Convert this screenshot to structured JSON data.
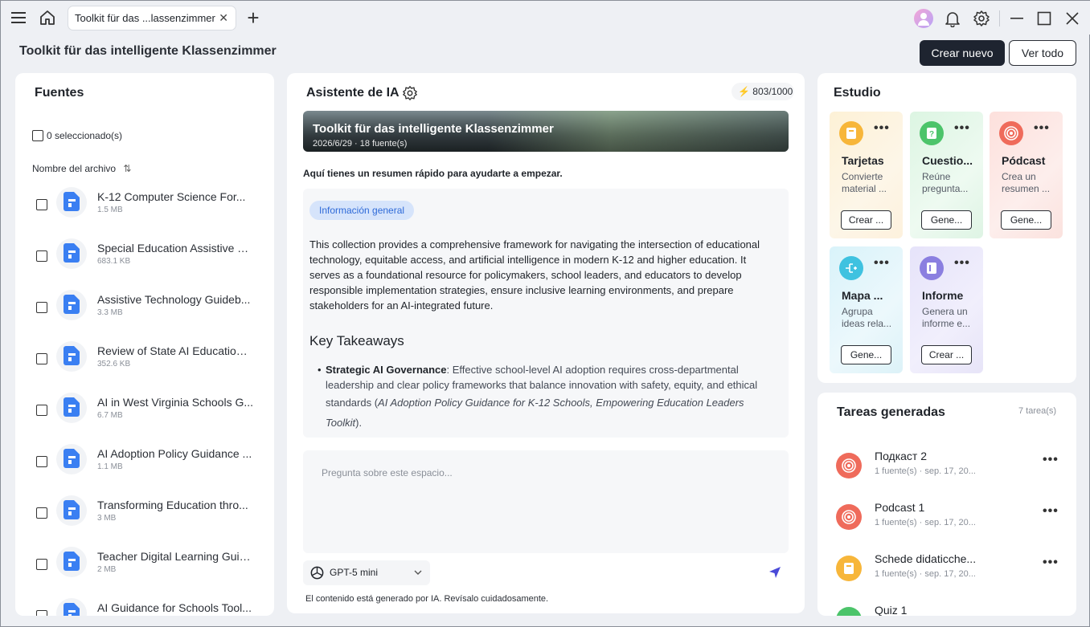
{
  "window": {
    "tab_title": "Toolkit für das ...lassenzimmer",
    "tab_close": "✕",
    "new_tab": "+"
  },
  "header": {
    "page_title": "Toolkit für das intelligente Klassenzimmer",
    "create_new": "Crear nuevo",
    "view_all": "Ver todo"
  },
  "sources": {
    "title": "Fuentes",
    "selected": "0 seleccionado(s)",
    "column": "Nombre del archivo",
    "items": [
      {
        "name": "K-12 Computer Science For...",
        "size": "1.5 MB"
      },
      {
        "name": "Special Education Assistive Te...",
        "size": "683.1 KB"
      },
      {
        "name": "Assistive Technology Guideb...",
        "size": "3.3 MB"
      },
      {
        "name": "Review of State AI Education ...",
        "size": "352.6 KB"
      },
      {
        "name": "AI in West Virginia Schools G...",
        "size": "6.7 MB"
      },
      {
        "name": "AI Adoption Policy Guidance ...",
        "size": "1.1 MB"
      },
      {
        "name": "Transforming Education thro...",
        "size": "3 MB"
      },
      {
        "name": "Teacher Digital Learning Guid...",
        "size": "2 MB"
      },
      {
        "name": "AI Guidance for Schools Tool...",
        "size": ""
      }
    ]
  },
  "assistant": {
    "title": "Asistente de IA",
    "credits": "803/1000",
    "banner_title": "Toolkit für das intelligente Klassenzimmer",
    "banner_meta": "2026/6/29 · 18 fuente(s)",
    "intro": "Aquí tienes un resumen rápido para ayudarte a empezar.",
    "badge": "Información general",
    "summary": "This collection provides a comprehensive framework for navigating the intersection of educational technology, equitable access, and artificial intelligence in modern K-12 and higher education. It serves as a foundational resource for policymakers, school leaders, and educators to develop responsible implementation strategies, ensure inclusive learning environments, and prepare stakeholders for an AI-integrated future.",
    "key_title": "Key Takeaways",
    "bullet_bold": "Strategic AI Governance",
    "bullet_text": ": Effective school-level AI adoption requires cross-departmental leadership and clear policy frameworks that balance innovation with safety, equity, and ethical standards (",
    "bullet_cite": "AI Adoption Policy Guidance for K-12 Schools, Empowering Education Leaders Toolkit",
    "bullet_end": ").",
    "input_placeholder": "Pregunta sobre este espacio...",
    "model": "GPT-5 mini",
    "disclaimer": "El contenido está generado por IA. Revísalo cuidadosamente."
  },
  "studio": {
    "title": "Estudio",
    "cards": [
      {
        "title": "Tarjetas",
        "desc": "Convierte material ...",
        "button": "Crear ...",
        "color": "#f7b63a",
        "icon": "cards-icon"
      },
      {
        "title": "Cuestio...",
        "desc": "Reúne pregunta...",
        "button": "Gene...",
        "color": "#4cc46a",
        "icon": "quiz-icon"
      },
      {
        "title": "Pódcast",
        "desc": "Crea un resumen ...",
        "button": "Gene...",
        "color": "#ef6b5b",
        "icon": "podcast-icon"
      },
      {
        "title": "Mapa ...",
        "desc": "Agrupa ideas rela...",
        "button": "Gene...",
        "color": "#3fc2e0",
        "icon": "mindmap-icon"
      },
      {
        "title": "Informe",
        "desc": "Genera un informe e...",
        "button": "Crear ...",
        "color": "#8b7fe0",
        "icon": "report-icon"
      }
    ]
  },
  "tasks": {
    "title": "Tareas generadas",
    "count": "7 tarea(s)",
    "items": [
      {
        "name": "Подкаст 2",
        "meta": "1 fuente(s) · sep. 17, 20...",
        "color": "#ef6b5b",
        "icon": "podcast-icon"
      },
      {
        "name": "Podcast 1",
        "meta": "1 fuente(s) · sep. 17, 20...",
        "color": "#ef6b5b",
        "icon": "podcast-icon"
      },
      {
        "name": "Schede didaticche...",
        "meta": "1 fuente(s) · sep. 17, 20...",
        "color": "#f7b63a",
        "icon": "cards-icon"
      },
      {
        "name": "Quiz 1",
        "meta": "",
        "color": "#4cc46a",
        "icon": "quiz-icon"
      }
    ]
  }
}
